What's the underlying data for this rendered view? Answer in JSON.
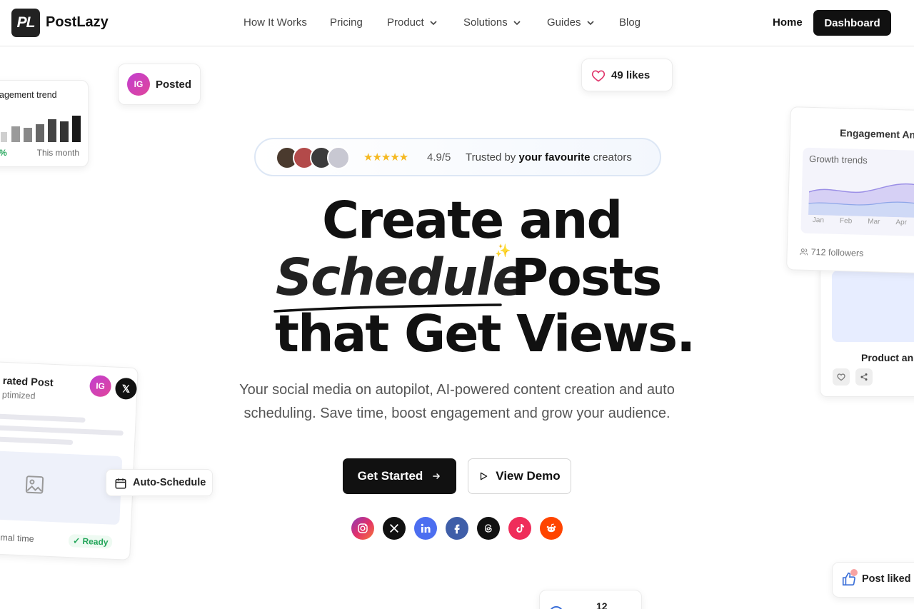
{
  "header": {
    "logo_mark": "PL",
    "brand": "PostLazy",
    "nav": [
      "How It Works",
      "Pricing",
      "Product",
      "Solutions",
      "Guides",
      "Blog"
    ],
    "home_link": "Home",
    "dashboard_button": "Dashboard"
  },
  "trend_card": {
    "title": "agement trend",
    "change": "%",
    "period": "This month"
  },
  "posted_card": {
    "badge": "IG",
    "label": "Posted"
  },
  "likes_card": {
    "label": "49 likes"
  },
  "analytics_card": {
    "title": "Engagement An",
    "subtitle": "Growth trends",
    "months": [
      "Jan",
      "Feb",
      "Mar",
      "Apr"
    ],
    "followers": "712 followers"
  },
  "product_card": {
    "title": "Product an"
  },
  "generated_card": {
    "title": "rated Post",
    "subtitle": "ptimized",
    "badge_ig": "IG",
    "badge_x": "𝕏",
    "time": "timal time",
    "status": "Ready"
  },
  "schedule_card": {
    "label": "Auto-Schedule"
  },
  "liked_card": {
    "label": "Post liked"
  },
  "number_card": {
    "label": "12"
  },
  "trust": {
    "stars": "★★★★★",
    "rating": "4.9/5",
    "prefix": "Trusted by ",
    "emphasis": "your favourite",
    "suffix": " creators"
  },
  "hero": {
    "line1": "Create and",
    "line2_italic": "Schedule",
    "line2_rest": "Posts",
    "line3": "that Get Views.",
    "sparkle": "✨",
    "subtext": "Your social media on autopilot, AI-powered content creation and auto scheduling. Save time, boost engagement and grow your audience."
  },
  "cta": {
    "primary": "Get Started",
    "secondary": "View Demo"
  },
  "colors": {
    "primary": "#111111",
    "accent_green": "#22a559",
    "star": "#f5b922"
  }
}
